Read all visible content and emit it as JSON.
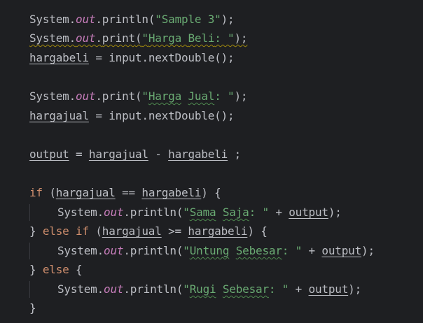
{
  "editor": {
    "colors": {
      "background": "#1e1f22",
      "default_text": "#bcbec4",
      "keyword": "#cf8e6d",
      "static_field": "#c77dbb",
      "string": "#6aab73",
      "indent_guide": "#393b40"
    },
    "tokens": {
      "system": "System",
      "dot": ".",
      "out": "out",
      "println": "println",
      "print": "print",
      "open_paren": "(",
      "close_semicolon": ");",
      "close_paren": ")",
      "semicolon": ";",
      "assign": " = ",
      "input_call": "input.nextDouble();",
      "minus": " - ",
      "space_semicolon": " ;",
      "if": "if",
      "else": "else",
      "else_if": "else if",
      "close_brace": "}",
      "open_brace": " {",
      "space": " ",
      "eq": " == ",
      "gte": " >= ",
      "plus": " + "
    },
    "vars": {
      "hargabeli": "hargabeli",
      "hargajual": "hargajual",
      "output": "output"
    },
    "strings": {
      "sample3": "\"Sample 3\"",
      "harga_beli_q": "\"",
      "harga_beli_w1": "Harga",
      "harga_beli_mid": " ",
      "harga_beli_w2": "Beli",
      "harga_beli_end": ": \"",
      "harga_jual_q": "\"",
      "harga_jual_w1": "Harga",
      "harga_jual_mid": " ",
      "harga_jual_w2": "Jual",
      "harga_jual_end": ": \"",
      "sama_q": "\"",
      "sama_w1": "Sama",
      "sama_mid": " ",
      "sama_w2": "Saja",
      "sama_end": ": \"",
      "untung_q": "\"",
      "untung_w1": "Untung",
      "untung_mid": " ",
      "untung_w2": "Sebesar",
      "untung_end": ": \"",
      "rugi_q": "\"",
      "rugi_w1": "Rugi",
      "rugi_mid": " ",
      "rugi_w2": "Sebesar",
      "rugi_end": ": \""
    }
  }
}
